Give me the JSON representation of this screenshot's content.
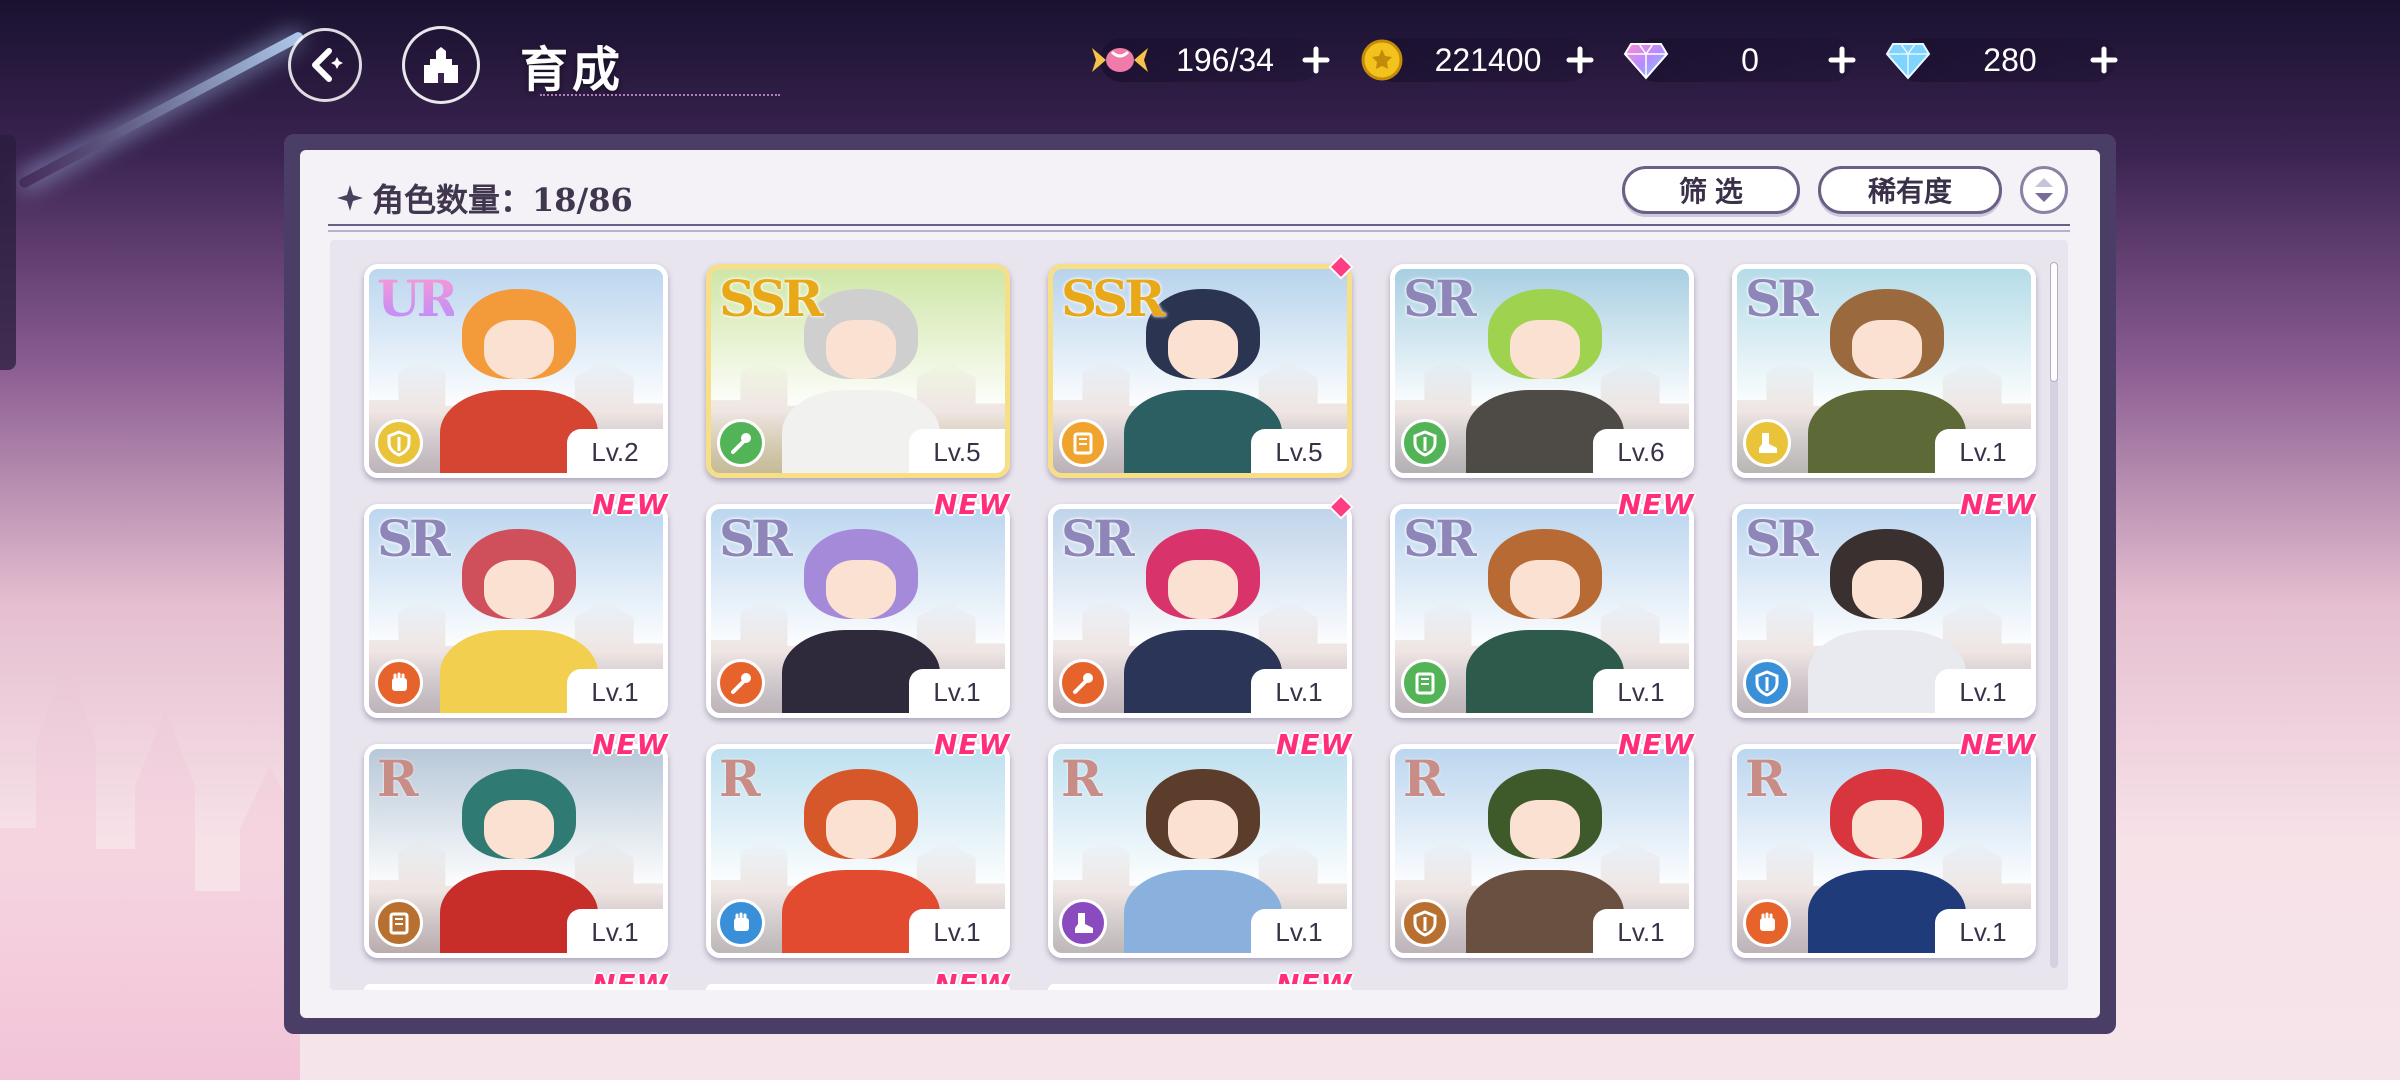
{
  "header": {
    "title": "育成",
    "currencies": [
      {
        "icon": "candy-icon",
        "value": "196/34",
        "color": "#e8a3c4"
      },
      {
        "icon": "gold-coin-icon",
        "value": "221400",
        "color": "#f4c21c"
      },
      {
        "icon": "rainbow-gem-icon",
        "value": "0",
        "color": "#c38cff"
      },
      {
        "icon": "diamond-icon",
        "value": "280",
        "color": "#7fd3ff"
      }
    ]
  },
  "panel": {
    "count_label": "角色数量：18/86",
    "filter_label": "筛 选",
    "rarity_label": "稀有度"
  },
  "characters": [
    {
      "rarity": "UR",
      "level": "Lv.2",
      "new": false,
      "dot": false,
      "class": "shield",
      "class_color": "#e9c33a",
      "hair": "#f39a3a",
      "outfit": "#d64531",
      "bg": "#bcd6ef"
    },
    {
      "rarity": "SSR",
      "level": "Lv.5",
      "new": false,
      "dot": false,
      "class": "wand",
      "class_color": "#52b456",
      "hair": "#cfcfcf",
      "outfit": "#f1f1ef",
      "bg": "#cfe6a6"
    },
    {
      "rarity": "SSR",
      "level": "Lv.5",
      "new": false,
      "dot": true,
      "class": "book",
      "class_color": "#f0a32d",
      "hair": "#2b3450",
      "outfit": "#2c5f61",
      "bg": "#b7d3ec"
    },
    {
      "rarity": "SR",
      "level": "Lv.6",
      "new": false,
      "dot": false,
      "class": "shield",
      "class_color": "#52b456",
      "hair": "#9fd24e",
      "outfit": "#4e4a45",
      "bg": "#a8cfe2"
    },
    {
      "rarity": "SR",
      "level": "Lv.1",
      "new": false,
      "dot": false,
      "class": "boot",
      "class_color": "#e9c33a",
      "hair": "#9a6a3e",
      "outfit": "#5d6a38",
      "bg": "#b5dce8"
    },
    {
      "rarity": "SR",
      "level": "Lv.1",
      "new": true,
      "dot": false,
      "class": "fist",
      "class_color": "#e6632c",
      "hair": "#cf4f5a",
      "outfit": "#f3cf50",
      "bg": "#bcd6ef"
    },
    {
      "rarity": "SR",
      "level": "Lv.1",
      "new": true,
      "dot": false,
      "class": "wand",
      "class_color": "#e6632c",
      "hair": "#a48ad9",
      "outfit": "#2e2a3b",
      "bg": "#bcd6ef"
    },
    {
      "rarity": "SR",
      "level": "Lv.1",
      "new": false,
      "dot": true,
      "class": "wand",
      "class_color": "#e6632c",
      "hair": "#d8336a",
      "outfit": "#2a3557",
      "bg": "#c0d4ea"
    },
    {
      "rarity": "SR",
      "level": "Lv.1",
      "new": true,
      "dot": false,
      "class": "book",
      "class_color": "#52b456",
      "hair": "#b86a35",
      "outfit": "#2d5a4a",
      "bg": "#bcd6ef"
    },
    {
      "rarity": "SR",
      "level": "Lv.1",
      "new": true,
      "dot": false,
      "class": "shield",
      "class_color": "#3a8fd9",
      "hair": "#3a3030",
      "outfit": "#e8eaf0",
      "bg": "#bcd6ef"
    },
    {
      "rarity": "R",
      "level": "Lv.1",
      "new": true,
      "dot": false,
      "class": "book",
      "class_color": "#b7702f",
      "hair": "#2f7a72",
      "outfit": "#c72e2a",
      "bg": "#b8c8d8"
    },
    {
      "rarity": "R",
      "level": "Lv.1",
      "new": true,
      "dot": false,
      "class": "fist",
      "class_color": "#3a8fd9",
      "hair": "#d6582a",
      "outfit": "#e24b2f",
      "bg": "#bfe0ef"
    },
    {
      "rarity": "R",
      "level": "Lv.1",
      "new": true,
      "dot": false,
      "class": "boot",
      "class_color": "#8a4bbf",
      "hair": "#5c3d2c",
      "outfit": "#8ab0de",
      "bg": "#bfe0ef"
    },
    {
      "rarity": "R",
      "level": "Lv.1",
      "new": true,
      "dot": false,
      "class": "shield",
      "class_color": "#b7702f",
      "hair": "#3f5a2a",
      "outfit": "#6a5040",
      "bg": "#bcd6ef"
    },
    {
      "rarity": "R",
      "level": "Lv.1",
      "new": true,
      "dot": false,
      "class": "fist",
      "class_color": "#e6632c",
      "hair": "#d8353f",
      "outfit": "#1f3b7a",
      "bg": "#bcd6ef"
    }
  ],
  "next_row_new": [
    "NEW",
    "NEW",
    "NEW"
  ]
}
